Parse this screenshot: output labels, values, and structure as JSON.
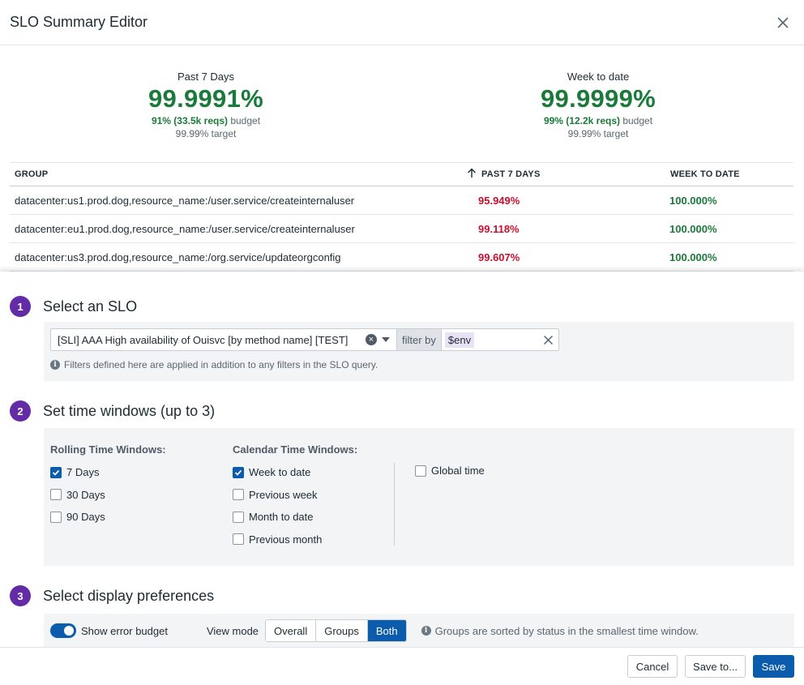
{
  "dialog": {
    "title": "SLO Summary Editor"
  },
  "summary": [
    {
      "label": "Past 7 Days",
      "value": "99.9991%",
      "budget_strong": "91% (33.5k reqs)",
      "budget_suffix": " budget",
      "target": "99.99% target"
    },
    {
      "label": "Week to date",
      "value": "99.9999%",
      "budget_strong": "99% (12.2k reqs)",
      "budget_suffix": " budget",
      "target": "99.99% target"
    }
  ],
  "table": {
    "headers": {
      "group": "GROUP",
      "past7": "PAST 7 DAYS",
      "wtd": "WEEK TO DATE"
    },
    "rows": [
      {
        "group": "datacenter:us1.prod.dog,resource_name:/user.service/createinternaluser",
        "past7": "95.949%",
        "wtd": "100.000%"
      },
      {
        "group": "datacenter:eu1.prod.dog,resource_name:/user.service/createinternaluser",
        "past7": "99.118%",
        "wtd": "100.000%"
      },
      {
        "group": "datacenter:us3.prod.dog,resource_name:/org.service/updateorgconfig",
        "past7": "99.607%",
        "wtd": "100.000%"
      }
    ]
  },
  "steps": [
    {
      "num": "1",
      "title": "Select an SLO"
    },
    {
      "num": "2",
      "title": "Set time windows (up to 3)"
    },
    {
      "num": "3",
      "title": "Select display preferences"
    }
  ],
  "slo_select": {
    "value": "[SLI] AAA High availability of Ouisvc [by method name] [TEST]",
    "filter_label": "filter by",
    "filter_tag": "$env",
    "info": "Filters defined here are applied in addition to any filters in the SLO query."
  },
  "time_windows": {
    "rolling_heading": "Rolling Time Windows:",
    "calendar_heading": "Calendar Time Windows:",
    "rolling": [
      {
        "label": "7 Days",
        "checked": true
      },
      {
        "label": "30 Days",
        "checked": false
      },
      {
        "label": "90 Days",
        "checked": false
      }
    ],
    "calendar": [
      {
        "label": "Week to date",
        "checked": true
      },
      {
        "label": "Previous week",
        "checked": false
      },
      {
        "label": "Month to date",
        "checked": false
      },
      {
        "label": "Previous month",
        "checked": false
      }
    ],
    "global": {
      "label": "Global time",
      "checked": false
    }
  },
  "display": {
    "toggle_label": "Show error budget",
    "toggle_on": true,
    "view_mode_label": "View mode",
    "view_modes": [
      "Overall",
      "Groups",
      "Both"
    ],
    "active_view_mode": "Both",
    "sort_info": "Groups are sorted by status in the smallest time window."
  },
  "footer": {
    "cancel": "Cancel",
    "save_to": "Save to...",
    "save": "Save"
  },
  "colors": {
    "good": "#1a7a3a",
    "bad": "#c8102e",
    "accent": "#0b5cad",
    "step": "#632ca6"
  }
}
